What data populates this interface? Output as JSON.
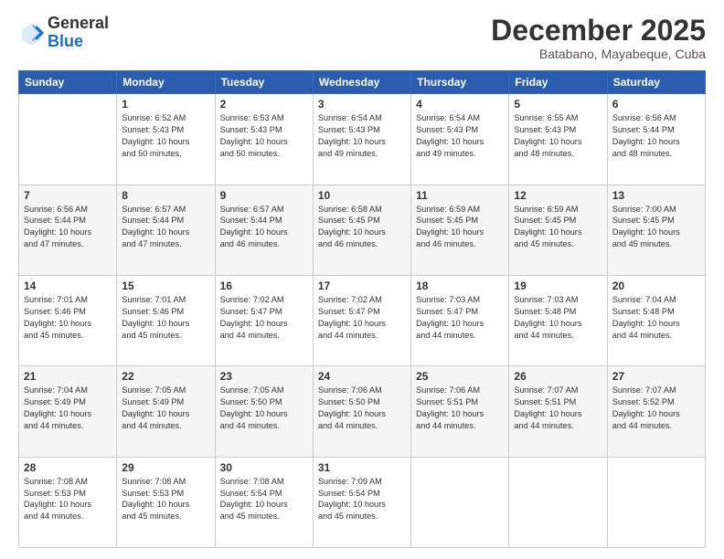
{
  "header": {
    "logo_general": "General",
    "logo_blue": "Blue",
    "month_year": "December 2025",
    "location": "Batabano, Mayabeque, Cuba"
  },
  "days_of_week": [
    "Sunday",
    "Monday",
    "Tuesday",
    "Wednesday",
    "Thursday",
    "Friday",
    "Saturday"
  ],
  "weeks": [
    [
      {
        "day": "",
        "info": ""
      },
      {
        "day": "1",
        "info": "Sunrise: 6:52 AM\nSunset: 5:43 PM\nDaylight: 10 hours\nand 50 minutes."
      },
      {
        "day": "2",
        "info": "Sunrise: 6:53 AM\nSunset: 5:43 PM\nDaylight: 10 hours\nand 50 minutes."
      },
      {
        "day": "3",
        "info": "Sunrise: 6:54 AM\nSunset: 5:43 PM\nDaylight: 10 hours\nand 49 minutes."
      },
      {
        "day": "4",
        "info": "Sunrise: 6:54 AM\nSunset: 5:43 PM\nDaylight: 10 hours\nand 49 minutes."
      },
      {
        "day": "5",
        "info": "Sunrise: 6:55 AM\nSunset: 5:43 PM\nDaylight: 10 hours\nand 48 minutes."
      },
      {
        "day": "6",
        "info": "Sunrise: 6:56 AM\nSunset: 5:44 PM\nDaylight: 10 hours\nand 48 minutes."
      }
    ],
    [
      {
        "day": "7",
        "info": "Sunrise: 6:56 AM\nSunset: 5:44 PM\nDaylight: 10 hours\nand 47 minutes."
      },
      {
        "day": "8",
        "info": "Sunrise: 6:57 AM\nSunset: 5:44 PM\nDaylight: 10 hours\nand 47 minutes."
      },
      {
        "day": "9",
        "info": "Sunrise: 6:57 AM\nSunset: 5:44 PM\nDaylight: 10 hours\nand 46 minutes."
      },
      {
        "day": "10",
        "info": "Sunrise: 6:58 AM\nSunset: 5:45 PM\nDaylight: 10 hours\nand 46 minutes."
      },
      {
        "day": "11",
        "info": "Sunrise: 6:59 AM\nSunset: 5:45 PM\nDaylight: 10 hours\nand 46 minutes."
      },
      {
        "day": "12",
        "info": "Sunrise: 6:59 AM\nSunset: 5:45 PM\nDaylight: 10 hours\nand 45 minutes."
      },
      {
        "day": "13",
        "info": "Sunrise: 7:00 AM\nSunset: 5:45 PM\nDaylight: 10 hours\nand 45 minutes."
      }
    ],
    [
      {
        "day": "14",
        "info": "Sunrise: 7:01 AM\nSunset: 5:46 PM\nDaylight: 10 hours\nand 45 minutes."
      },
      {
        "day": "15",
        "info": "Sunrise: 7:01 AM\nSunset: 5:46 PM\nDaylight: 10 hours\nand 45 minutes."
      },
      {
        "day": "16",
        "info": "Sunrise: 7:02 AM\nSunset: 5:47 PM\nDaylight: 10 hours\nand 44 minutes."
      },
      {
        "day": "17",
        "info": "Sunrise: 7:02 AM\nSunset: 5:47 PM\nDaylight: 10 hours\nand 44 minutes."
      },
      {
        "day": "18",
        "info": "Sunrise: 7:03 AM\nSunset: 5:47 PM\nDaylight: 10 hours\nand 44 minutes."
      },
      {
        "day": "19",
        "info": "Sunrise: 7:03 AM\nSunset: 5:48 PM\nDaylight: 10 hours\nand 44 minutes."
      },
      {
        "day": "20",
        "info": "Sunrise: 7:04 AM\nSunset: 5:48 PM\nDaylight: 10 hours\nand 44 minutes."
      }
    ],
    [
      {
        "day": "21",
        "info": "Sunrise: 7:04 AM\nSunset: 5:49 PM\nDaylight: 10 hours\nand 44 minutes."
      },
      {
        "day": "22",
        "info": "Sunrise: 7:05 AM\nSunset: 5:49 PM\nDaylight: 10 hours\nand 44 minutes."
      },
      {
        "day": "23",
        "info": "Sunrise: 7:05 AM\nSunset: 5:50 PM\nDaylight: 10 hours\nand 44 minutes."
      },
      {
        "day": "24",
        "info": "Sunrise: 7:06 AM\nSunset: 5:50 PM\nDaylight: 10 hours\nand 44 minutes."
      },
      {
        "day": "25",
        "info": "Sunrise: 7:06 AM\nSunset: 5:51 PM\nDaylight: 10 hours\nand 44 minutes."
      },
      {
        "day": "26",
        "info": "Sunrise: 7:07 AM\nSunset: 5:51 PM\nDaylight: 10 hours\nand 44 minutes."
      },
      {
        "day": "27",
        "info": "Sunrise: 7:07 AM\nSunset: 5:52 PM\nDaylight: 10 hours\nand 44 minutes."
      }
    ],
    [
      {
        "day": "28",
        "info": "Sunrise: 7:08 AM\nSunset: 5:53 PM\nDaylight: 10 hours\nand 44 minutes."
      },
      {
        "day": "29",
        "info": "Sunrise: 7:08 AM\nSunset: 5:53 PM\nDaylight: 10 hours\nand 45 minutes."
      },
      {
        "day": "30",
        "info": "Sunrise: 7:08 AM\nSunset: 5:54 PM\nDaylight: 10 hours\nand 45 minutes."
      },
      {
        "day": "31",
        "info": "Sunrise: 7:09 AM\nSunset: 5:54 PM\nDaylight: 10 hours\nand 45 minutes."
      },
      {
        "day": "",
        "info": ""
      },
      {
        "day": "",
        "info": ""
      },
      {
        "day": "",
        "info": ""
      }
    ]
  ]
}
